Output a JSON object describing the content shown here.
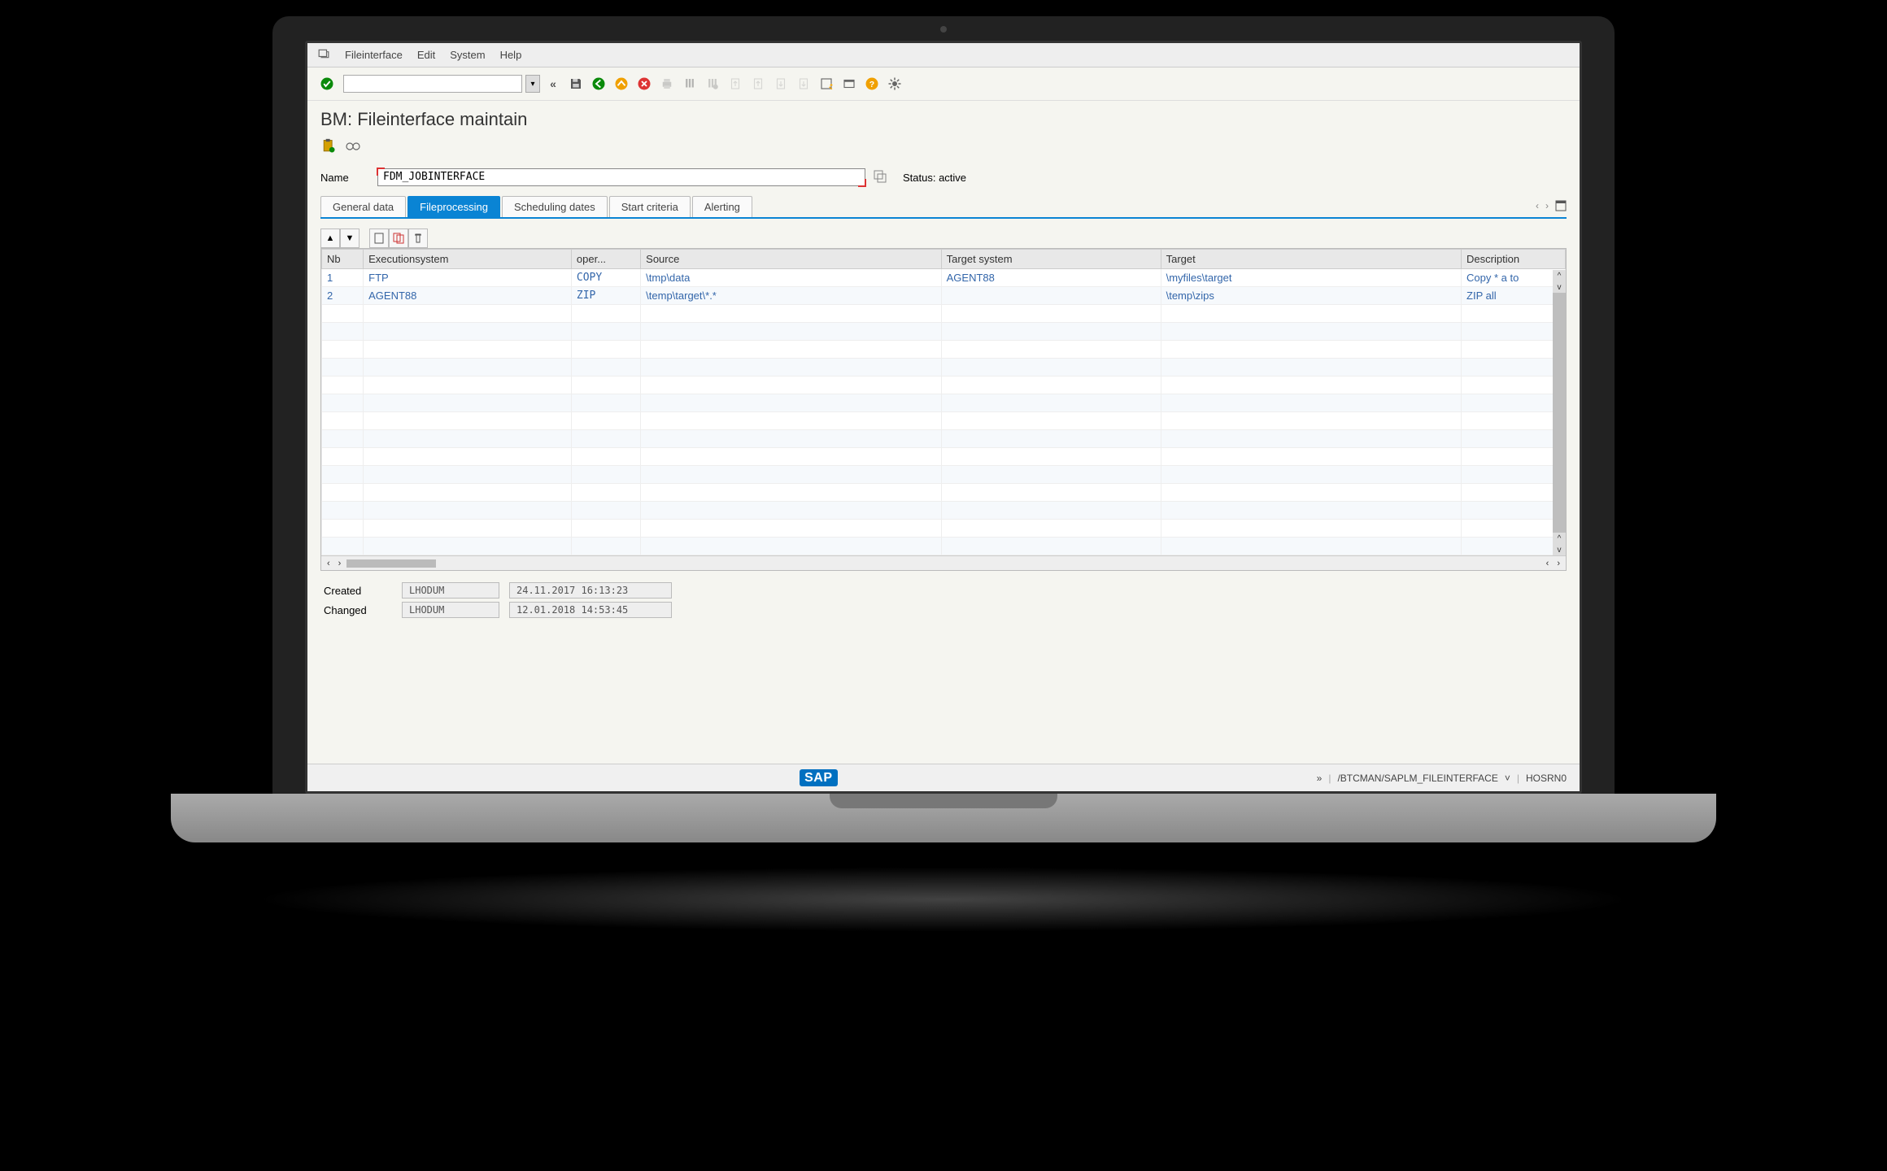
{
  "menu": {
    "items": [
      "Fileinterface",
      "Edit",
      "System",
      "Help"
    ]
  },
  "page_title": "BM: Fileinterface maintain",
  "name_row": {
    "label": "Name",
    "value": "FDM_JOBINTERFACE",
    "status": "Status: active"
  },
  "tabs": [
    "General data",
    "Fileprocessing",
    "Scheduling dates",
    "Start criteria",
    "Alerting"
  ],
  "active_tab_index": 1,
  "grid": {
    "headers": [
      "Nb",
      "Executionsystem",
      "oper...",
      "Source",
      "Target system",
      "Target",
      "Description"
    ],
    "rows": [
      {
        "nb": "1",
        "exec": "FTP",
        "oper": "COPY",
        "source": "\\tmp\\data",
        "tsys": "AGENT88",
        "target": "\\myfiles\\target",
        "desc": "Copy * a to"
      },
      {
        "nb": "2",
        "exec": "AGENT88",
        "oper": "ZIP",
        "source": "\\temp\\target\\*.*",
        "tsys": "",
        "target": "\\temp\\zips",
        "desc": "ZIP all"
      }
    ],
    "blank_rows": 14
  },
  "footer": {
    "created_label": "Created",
    "changed_label": "Changed",
    "created_user": "LHODUM",
    "created_ts": "24.11.2017 16:13:23",
    "changed_user": "LHODUM",
    "changed_ts": "12.01.2018 14:53:45"
  },
  "statusbar": {
    "more": "»",
    "transaction": "/BTCMAN/SAPLM_FILEINTERFACE",
    "host": "HOSRN0"
  }
}
